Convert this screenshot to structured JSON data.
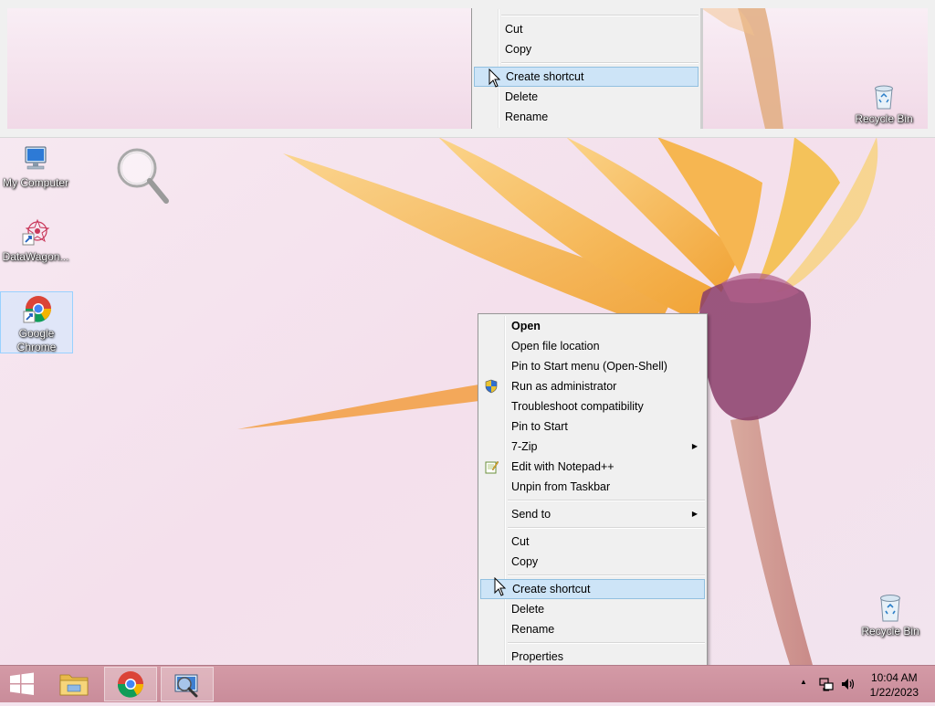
{
  "desktop": {
    "icons": [
      {
        "name": "My Computer"
      },
      {
        "name": "DataWagon..."
      },
      {
        "name": "Google Chrome"
      },
      {
        "name": "Recycle Bin"
      }
    ]
  },
  "magnifier": {
    "menu_items": [
      "Cut",
      "Copy",
      "Create shortcut",
      "Delete",
      "Rename"
    ],
    "recycle_bin_label": "Recycle Bin"
  },
  "context_menu": {
    "items": [
      {
        "label": "Open"
      },
      {
        "label": "Open file location"
      },
      {
        "label": "Pin to Start menu (Open-Shell)"
      },
      {
        "label": "Run as administrator",
        "icon": "uac-shield-icon"
      },
      {
        "label": "Troubleshoot compatibility"
      },
      {
        "label": "Pin to Start"
      },
      {
        "label": "7-Zip",
        "submenu": true
      },
      {
        "label": "Edit with Notepad++",
        "icon": "notepadpp-icon"
      },
      {
        "label": "Unpin from Taskbar"
      },
      {
        "label": "Send to",
        "submenu": true
      },
      {
        "label": "Cut"
      },
      {
        "label": "Copy"
      },
      {
        "label": "Create shortcut",
        "highlighted": true
      },
      {
        "label": "Delete"
      },
      {
        "label": "Rename"
      },
      {
        "label": "Properties"
      }
    ],
    "submenu_arrow": "▶"
  },
  "taskbar": {
    "start_icon": "windows-logo-icon",
    "pinned": [
      "file-explorer-icon",
      "chrome-icon",
      "magnifier-icon"
    ],
    "tray_overflow": "▲",
    "clock_time": "10:04 AM",
    "clock_date": "1/22/2023"
  },
  "colors": {
    "menu_bg": "#f0f0f0",
    "menu_highlight": "#cde4f7",
    "menu_highlight_border": "#92c0e0",
    "taskbar": "#cf93a1",
    "wallpaper": "#f4e4ee"
  }
}
